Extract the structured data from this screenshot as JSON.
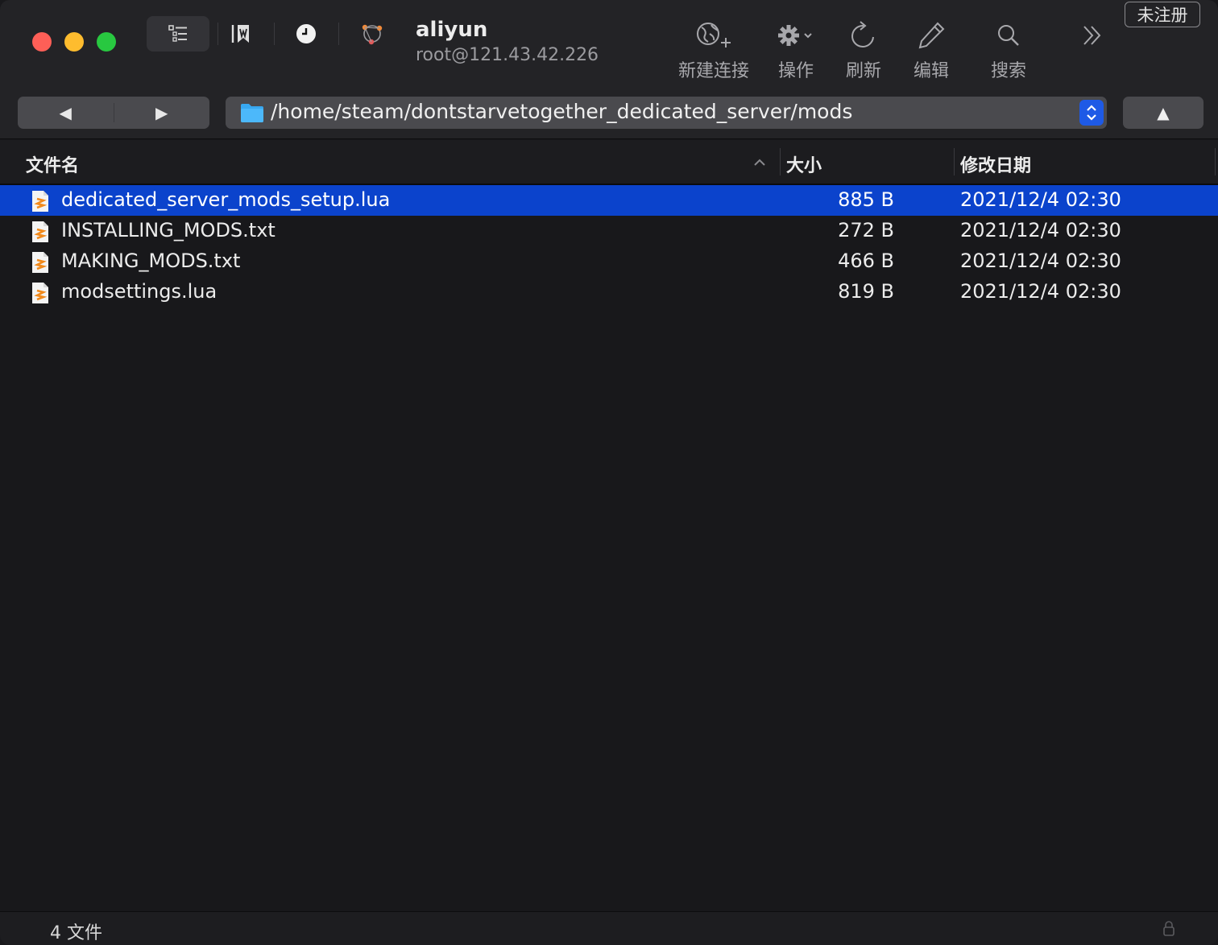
{
  "toolbar": {
    "connection_name": "aliyun",
    "connection_host": "root@121.43.42.226",
    "actions": [
      {
        "label": "新建连接",
        "icon": "globe-plus-icon"
      },
      {
        "label": "操作",
        "icon": "gear-icon"
      },
      {
        "label": "刷新",
        "icon": "refresh-icon"
      },
      {
        "label": "编辑",
        "icon": "pencil-icon"
      },
      {
        "label": "搜索",
        "icon": "search-icon"
      }
    ],
    "register_label": "未注册"
  },
  "navigation": {
    "back_glyph": "◀",
    "forward_glyph": "▶",
    "up_glyph": "▲",
    "path": "/home/steam/dontstarvetogether_dedicated_server/mods"
  },
  "columns": {
    "name": "文件名",
    "size": "大小",
    "date": "修改日期"
  },
  "files": [
    {
      "name": "dedicated_server_mods_setup.lua",
      "size": "885 B",
      "date": "2021/12/4 02:30",
      "selected": true
    },
    {
      "name": "INSTALLING_MODS.txt",
      "size": "272 B",
      "date": "2021/12/4 02:30",
      "selected": false
    },
    {
      "name": "MAKING_MODS.txt",
      "size": "466 B",
      "date": "2021/12/4 02:30",
      "selected": false
    },
    {
      "name": "modsettings.lua",
      "size": "819 B",
      "date": "2021/12/4 02:30",
      "selected": false
    }
  ],
  "status": {
    "count_label": "4 文件"
  },
  "colors": {
    "selection": "#0b43cc",
    "accent": "#1e5ae6",
    "file_icon": "#f28a1c"
  }
}
